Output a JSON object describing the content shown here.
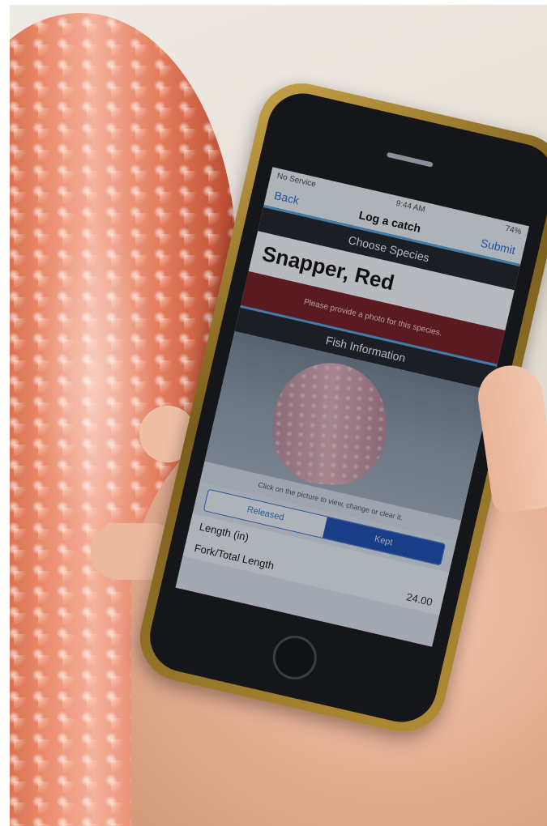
{
  "status_bar": {
    "carrier": "No Service",
    "time": "9:44 AM",
    "battery": "74%"
  },
  "nav": {
    "back": "Back",
    "title": "Log a catch",
    "submit": "Submit"
  },
  "choose_species": {
    "header": "Choose Species",
    "selected": "Snapper, Red"
  },
  "photo_alert": "Please provide a photo for this species.",
  "fish_information": {
    "header": "Fish Information",
    "photo_hint": "Click on the picture to view, change or clear it.",
    "disposition_options": [
      "Released",
      "Kept"
    ],
    "selected_disposition": "Kept",
    "length_label": "Length (in)",
    "fork_length_label": "Fork/Total Length",
    "fork_length_value": "24.00"
  }
}
